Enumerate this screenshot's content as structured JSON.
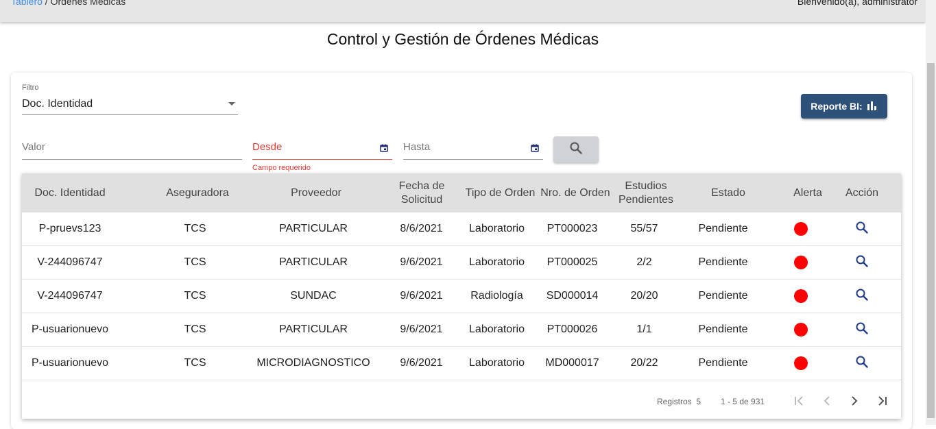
{
  "header": {
    "breadcrumb_link": "Tablero",
    "breadcrumb_sep": " / ",
    "breadcrumb_current": "Órdenes Médicas",
    "welcome": "Bienvenido(a), administrator"
  },
  "page_title": "Control y Gestión de Órdenes Médicas",
  "filters": {
    "filter_label": "Filtro",
    "filter_value": "Doc. Identidad",
    "valor_placeholder": "Valor",
    "desde_placeholder": "Desde",
    "desde_error": "Campo requerido",
    "hasta_placeholder": "Hasta"
  },
  "report_button": {
    "label": "Reporte BI:",
    "icon": "bar-chart-icon"
  },
  "table": {
    "headers": {
      "doc": "Doc. Identidad",
      "aseguradora": "Aseguradora",
      "proveedor": "Proveedor",
      "fecha_l1": "Fecha de",
      "fecha_l2": "Solicitud",
      "tipo": "Tipo de Orden",
      "orden": "Nro. de Orden",
      "estudios_l1": "Estudios",
      "estudios_l2": "Pendientes",
      "estado": "Estado",
      "alerta": "Alerta",
      "accion": "Acción"
    },
    "rows": [
      {
        "doc": "P-pruevs123",
        "aseguradora": "TCS",
        "proveedor": "PARTICULAR",
        "fecha": "8/6/2021",
        "tipo": "Laboratorio",
        "orden": "PT000023",
        "estudios": "55/57",
        "estado": "Pendiente"
      },
      {
        "doc": "V-244096747",
        "aseguradora": "TCS",
        "proveedor": "PARTICULAR",
        "fecha": "9/6/2021",
        "tipo": "Laboratorio",
        "orden": "PT000025",
        "estudios": "2/2",
        "estado": "Pendiente"
      },
      {
        "doc": "V-244096747",
        "aseguradora": "TCS",
        "proveedor": "SUNDAC",
        "fecha": "9/6/2021",
        "tipo": "Radiología",
        "orden": "SD000014",
        "estudios": "20/20",
        "estado": "Pendiente"
      },
      {
        "doc": "P-usuarionuevo",
        "aseguradora": "TCS",
        "proveedor": "PARTICULAR",
        "fecha": "9/6/2021",
        "tipo": "Laboratorio",
        "orden": "PT000026",
        "estudios": "1/1",
        "estado": "Pendiente"
      },
      {
        "doc": "P-usuarionuevo",
        "aseguradora": "TCS",
        "proveedor": "MICRODIAGNOSTICO",
        "fecha": "9/6/2021",
        "tipo": "Laboratorio",
        "orden": "MD000017",
        "estudios": "20/22",
        "estado": "Pendiente"
      }
    ],
    "alert_color": "#ff0000"
  },
  "paginator": {
    "label": "Registros",
    "page_size": "5",
    "range": "1 - 5 de 931"
  },
  "colors": {
    "report_button": "#2d5178",
    "link": "#3f8ee8",
    "error": "#e53935",
    "header_bg": "#e0e0e0"
  }
}
